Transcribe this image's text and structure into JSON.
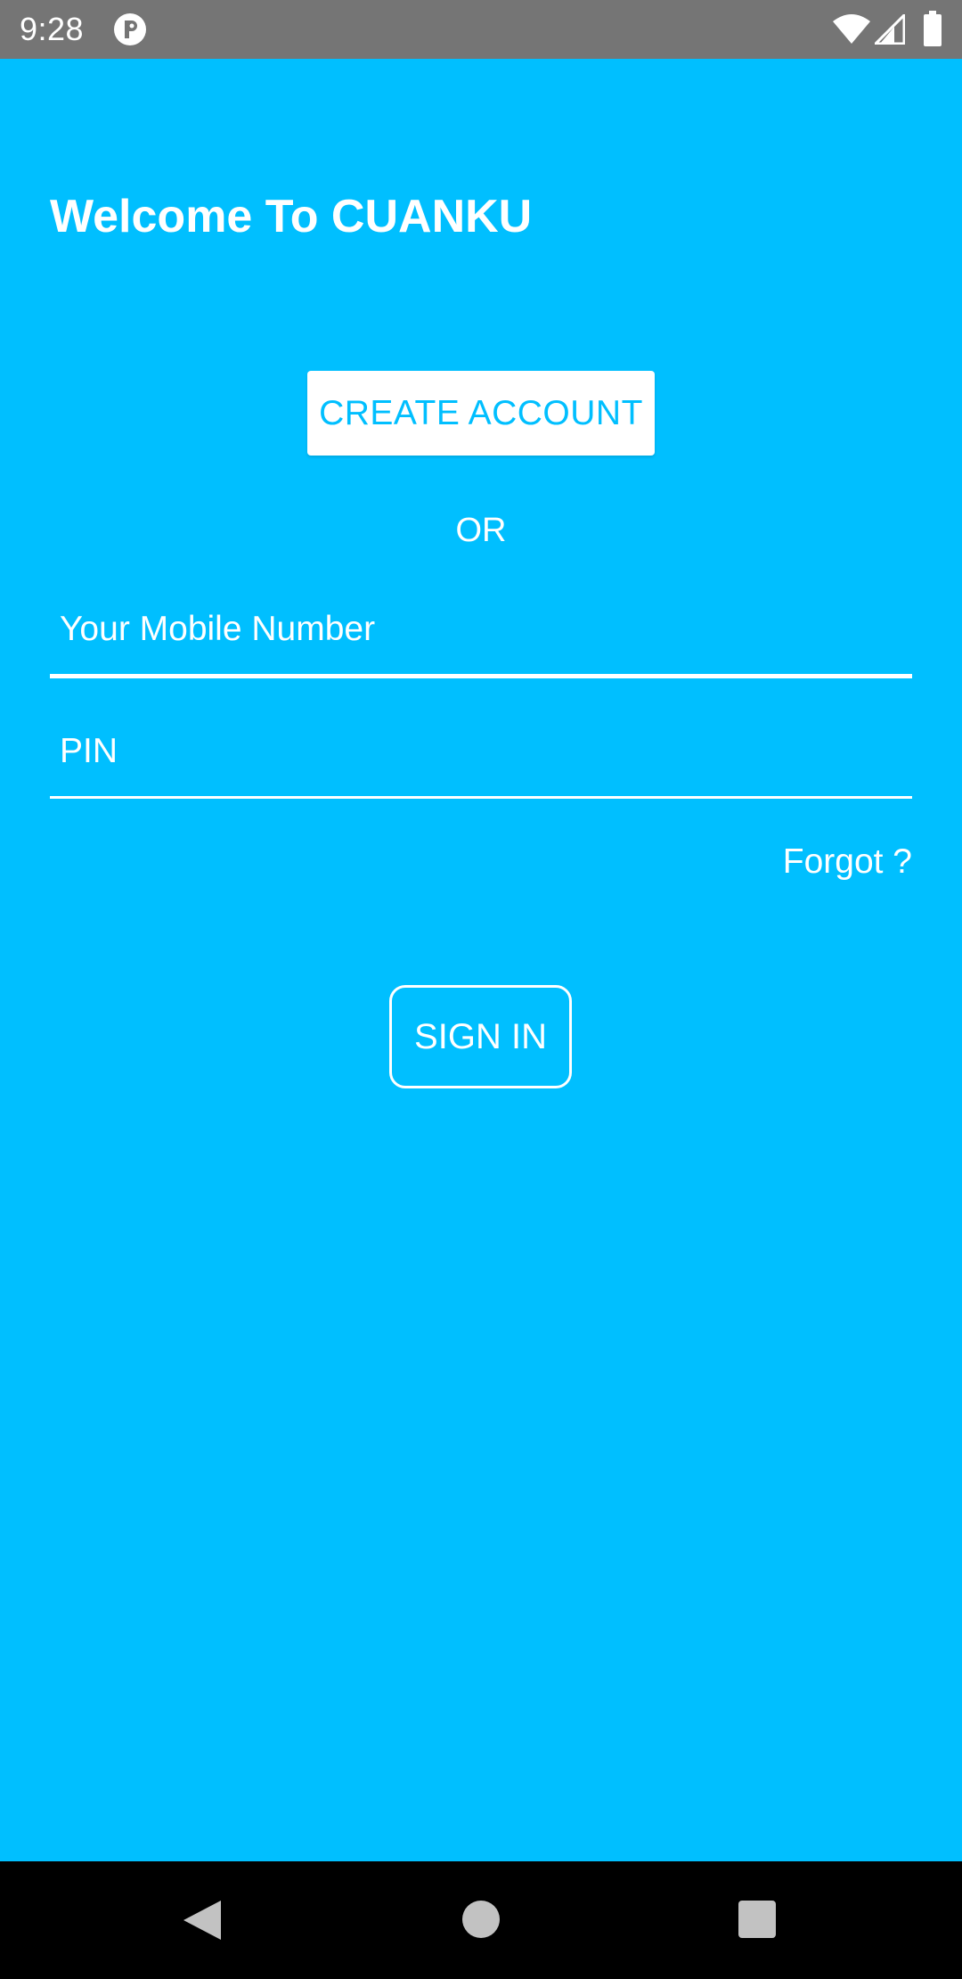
{
  "status_bar": {
    "time": "9:28",
    "icons": [
      "app-notification-icon",
      "wifi-icon",
      "signal-icon",
      "battery-icon"
    ]
  },
  "welcome": {
    "title": "Welcome To CUANKU"
  },
  "create_account": {
    "label": "CREATE ACCOUNT"
  },
  "divider": {
    "or_label": "OR"
  },
  "form": {
    "mobile_placeholder": "Your Mobile Number",
    "mobile_value": "",
    "pin_placeholder": "PIN",
    "pin_value": ""
  },
  "forgot": {
    "label": "Forgot ?"
  },
  "sign_in": {
    "label": "SIGN IN"
  },
  "nav_bar": {
    "icons": [
      "back-icon",
      "home-icon",
      "recents-icon"
    ]
  },
  "colors": {
    "background": "#00BFFF",
    "status_bar": "#757575",
    "text": "#FFFFFF",
    "nav_bar": "#000000"
  }
}
